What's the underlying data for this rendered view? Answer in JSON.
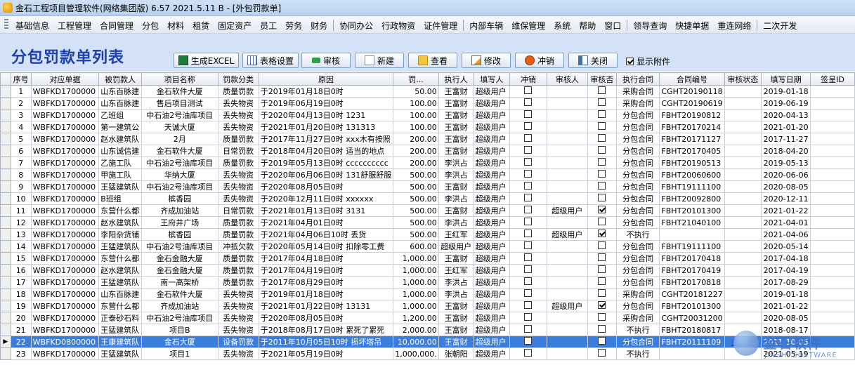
{
  "window": {
    "title": "金石工程项目管理软件(网络集团版) 6.57   2021.5.11 B - [外包罚款单]"
  },
  "menu": [
    "基础信息",
    "工程管理",
    "合同管理",
    "分包",
    "材料",
    "租赁",
    "固定资产",
    "员工",
    "劳务",
    "财务",
    "|",
    "协同办公",
    "行政物资",
    "证件管理",
    "|",
    "内部车辆",
    "维保管理",
    "系统",
    "帮助",
    "窗口",
    "|",
    "领导查询",
    "快捷单据",
    "重连网络",
    "|",
    "二次开发"
  ],
  "page_title": "分包罚款单列表",
  "toolbar": {
    "excel": "生成EXCEL",
    "table_settings": "表格设置",
    "approve": "审核",
    "new": "新建",
    "view": "查看",
    "edit": "修改",
    "offset": "冲销",
    "close": "关闭",
    "show_attachments": "显示附件",
    "show_attachments_checked": true
  },
  "columns": [
    "序号",
    "对应单据",
    "被罚款人",
    "项目名称",
    "罚款分类",
    "原因",
    "罚...",
    "执行人",
    "填写人",
    "冲销",
    "审核人",
    "审核否",
    "执行合同",
    "合同编号",
    "审核状态",
    "填写日期",
    "签呈ID"
  ],
  "rows": [
    {
      "no": "1",
      "doc": "WBFKD1700000",
      "person": "山东百脉建",
      "project": "金石软件大厦",
      "type": "质量罚款",
      "reason": "于2019年01月18日0时",
      "amount": "50.00",
      "exec": "王富财",
      "filler": "超级用户",
      "cx": false,
      "reviewer": "",
      "approved": false,
      "contract": "采购合同",
      "cno": "CGHT20190118",
      "status": "",
      "date": "2019-01-18",
      "sign": ""
    },
    {
      "no": "2",
      "doc": "WBFKD1700000",
      "person": "山东百脉建",
      "project": "售后项目测试",
      "type": "丢失物资",
      "reason": "于2019年06月19日0时",
      "amount": "100.00",
      "exec": "王富财",
      "filler": "超级用户",
      "cx": false,
      "reviewer": "",
      "approved": false,
      "contract": "采购合同",
      "cno": "CGHT20190619",
      "status": "",
      "date": "2019-06-19",
      "sign": ""
    },
    {
      "no": "3",
      "doc": "WBFKD1700000",
      "person": "乙班组",
      "project": "中石油2号油库项目",
      "type": "丢失物资",
      "reason": "于2020年04月13日0时  1231",
      "amount": "100.00",
      "exec": "王富财",
      "filler": "超级用户",
      "cx": false,
      "reviewer": "",
      "approved": false,
      "contract": "分包合同",
      "cno": "FBHT20190812",
      "status": "",
      "date": "2020-04-13",
      "sign": ""
    },
    {
      "no": "4",
      "doc": "WBFKD1700000",
      "person": "第一建筑公",
      "project": "天诚大厦",
      "type": "丢失物资",
      "reason": "于2021年01月20日0时  131313",
      "amount": "100.00",
      "exec": "王富财",
      "filler": "超级用户",
      "cx": false,
      "reviewer": "",
      "approved": false,
      "contract": "分包合同",
      "cno": "FBHT20170214",
      "status": "",
      "date": "2021-01-20",
      "sign": ""
    },
    {
      "no": "5",
      "doc": "WBFKD1700000",
      "person": "赵水建筑队",
      "project": "2月",
      "type": "质量罚款",
      "reason": "于2017年11月27日0时  xxx木有按照",
      "amount": "200.00",
      "exec": "王富财",
      "filler": "超级用户",
      "cx": false,
      "reviewer": "",
      "approved": false,
      "contract": "分包合同",
      "cno": "FBHT20171127",
      "status": "",
      "date": "2017-11-27",
      "sign": ""
    },
    {
      "no": "6",
      "doc": "WBFKD1700000",
      "person": "山东诚信建",
      "project": "金石软件大厦",
      "type": "日常罚款",
      "reason": "于2018年04月20日0时  适当的地点",
      "amount": "200.00",
      "exec": "王富财",
      "filler": "超级用户",
      "cx": false,
      "reviewer": "",
      "approved": false,
      "contract": "分包合同",
      "cno": "FBHT20170405",
      "status": "",
      "date": "2018-04-20",
      "sign": ""
    },
    {
      "no": "7",
      "doc": "WBFKD1700000",
      "person": "乙施工队",
      "project": "中石油2号油库项目",
      "type": "质量罚款",
      "reason": "于2019年05月13日0时  cccccccccc",
      "amount": "200.00",
      "exec": "李洪占",
      "filler": "超级用户",
      "cx": false,
      "reviewer": "",
      "approved": false,
      "contract": "分包合同",
      "cno": "FBHT20190513",
      "status": "",
      "date": "2019-05-13",
      "sign": ""
    },
    {
      "no": "8",
      "doc": "WBFKD1700000",
      "person": "甲施工队",
      "project": "华纳大厦",
      "type": "丢失物资",
      "reason": "于2020年06月06日0时  131舒服舒服",
      "amount": "500.00",
      "exec": "李洪占",
      "filler": "超级用户",
      "cx": false,
      "reviewer": "",
      "approved": false,
      "contract": "分包合同",
      "cno": "FBHT20060600",
      "status": "",
      "date": "2020-06-06",
      "sign": ""
    },
    {
      "no": "9",
      "doc": "WBFKD1700000",
      "person": "王猛建筑队",
      "project": "中石油2号油库项目",
      "type": "丢失物资",
      "reason": "于2020年08月05日0时",
      "amount": "500.00",
      "exec": "王富财",
      "filler": "超级用户",
      "cx": false,
      "reviewer": "",
      "approved": false,
      "contract": "分包合同",
      "cno": "FBHT19111100",
      "status": "",
      "date": "2020-08-05",
      "sign": ""
    },
    {
      "no": "10",
      "doc": "WBFKD1700000",
      "person": "B班组",
      "project": "槟香园",
      "type": "丢失物资",
      "reason": "于2020年12月11日0时  xxxxxx",
      "amount": "500.00",
      "exec": "李洪占",
      "filler": "超级用户",
      "cx": false,
      "reviewer": "",
      "approved": false,
      "contract": "分包合同",
      "cno": "FBHT20092800",
      "status": "",
      "date": "2020-12-11",
      "sign": ""
    },
    {
      "no": "11",
      "doc": "WBFKD1700000",
      "person": "东营什么都",
      "project": "齐成加油站",
      "type": "日常罚款",
      "reason": "于2021年01月13日0时  3131",
      "amount": "500.00",
      "exec": "王富财",
      "filler": "超级用户",
      "cx": false,
      "reviewer": "超级用户",
      "approved": true,
      "contract": "分包合同",
      "cno": "FBHT20101300",
      "status": "",
      "date": "2021-01-22",
      "sign": ""
    },
    {
      "no": "12",
      "doc": "WBFKD1700000",
      "person": "赵水建筑队",
      "project": "王府井广场",
      "type": "质量罚款",
      "reason": "于2021年04月01日0时",
      "amount": "500.00",
      "exec": "李洪占",
      "filler": "超级用户",
      "cx": false,
      "reviewer": "",
      "approved": false,
      "contract": "分包合同",
      "cno": "FBHT21040100",
      "status": "",
      "date": "2021-04-01",
      "sign": ""
    },
    {
      "no": "13",
      "doc": "WBFKD1700000",
      "person": "李阳杂货铺",
      "project": "槟香园",
      "type": "质量罚款",
      "reason": "于2021年04月06日10时  丢货",
      "amount": "500.00",
      "exec": "王红军",
      "filler": "超级用户",
      "cx": false,
      "reviewer": "超级用户",
      "approved": true,
      "contract": "不执行",
      "cno": "",
      "status": "",
      "date": "2021-04-06",
      "sign": ""
    },
    {
      "no": "14",
      "doc": "WBFKD1700000",
      "person": "王猛建筑队",
      "project": "中石油2号油库项目",
      "type": "冲抵欠款",
      "reason": "于2020年05月14日0时  扣除零工费",
      "amount": "600.00",
      "exec": "超级用户",
      "filler": "超级用户",
      "cx": false,
      "reviewer": "",
      "approved": false,
      "contract": "分包合同",
      "cno": "FBHT19111100",
      "status": "",
      "date": "2020-05-14",
      "sign": ""
    },
    {
      "no": "15",
      "doc": "WBFKD1700000",
      "person": "东营什么都",
      "project": "金石金融大厦",
      "type": "质量罚款",
      "reason": "于2017年04月18日0时",
      "amount": "1,000.00",
      "exec": "王富财",
      "filler": "超级用户",
      "cx": false,
      "reviewer": "",
      "approved": false,
      "contract": "分包合同",
      "cno": "FBHT20170418",
      "status": "",
      "date": "2017-04-18",
      "sign": ""
    },
    {
      "no": "16",
      "doc": "WBFKD1700000",
      "person": "赵水建筑队",
      "project": "金石金融大厦",
      "type": "质量罚款",
      "reason": "于2017年04月19日0时",
      "amount": "1,000.00",
      "exec": "王红军",
      "filler": "超级用户",
      "cx": false,
      "reviewer": "",
      "approved": false,
      "contract": "分包合同",
      "cno": "FBHT20170419",
      "status": "",
      "date": "2017-04-19",
      "sign": ""
    },
    {
      "no": "17",
      "doc": "WBFKD1700000",
      "person": "王猛建筑队",
      "project": "南一高架桥",
      "type": "质量罚款",
      "reason": "于2017年08月29日0时",
      "amount": "1,000.00",
      "exec": "李洪占",
      "filler": "超级用户",
      "cx": false,
      "reviewer": "",
      "approved": false,
      "contract": "分包合同",
      "cno": "FBHT20170818",
      "status": "",
      "date": "2017-08-29",
      "sign": ""
    },
    {
      "no": "18",
      "doc": "WBFKD1700000",
      "person": "山东百脉建",
      "project": "金石软件大厦",
      "type": "丢失物资",
      "reason": "于2019年01月18日0时",
      "amount": "1,000.00",
      "exec": "李洪占",
      "filler": "超级用户",
      "cx": false,
      "reviewer": "",
      "approved": false,
      "contract": "采购合同",
      "cno": "CGHT20181227",
      "status": "",
      "date": "2019-01-18",
      "sign": ""
    },
    {
      "no": "19",
      "doc": "WBFKD1700000",
      "person": "东营什么都",
      "project": "齐成加油站",
      "type": "丢失物资",
      "reason": "于2021年01月22日0时  13131",
      "amount": "1,000.00",
      "exec": "王富财",
      "filler": "超级用户",
      "cx": false,
      "reviewer": "超级用户",
      "approved": true,
      "contract": "分包合同",
      "cno": "FBHT20101300",
      "status": "",
      "date": "2021-01-22",
      "sign": ""
    },
    {
      "no": "20",
      "doc": "WBFKD1700000",
      "person": "正泰砂石料",
      "project": "中石油2号油库项目",
      "type": "丢失物资",
      "reason": "于2020年08月05日0时",
      "amount": "1,200.00",
      "exec": "王富财",
      "filler": "超级用户",
      "cx": false,
      "reviewer": "",
      "approved": false,
      "contract": "采购合同",
      "cno": "CGHT20031200",
      "status": "",
      "date": "2020-08-05",
      "sign": ""
    },
    {
      "no": "21",
      "doc": "WBFKD1700000",
      "person": "王猛建筑队",
      "project": "项目B",
      "type": "丢失物资",
      "reason": "于2018年08月17日0时  累死了累死",
      "amount": "2,000.00",
      "exec": "王富财",
      "filler": "超级用户",
      "cx": false,
      "reviewer": "",
      "approved": false,
      "contract": "不执行",
      "cno": "FBHT20180817",
      "status": "",
      "date": "2018-08-17",
      "sign": ""
    },
    {
      "no": "22",
      "doc": "WBFKD0800000",
      "person": "王康建筑队",
      "project": "金石大厦",
      "type": "设备罚款",
      "reason": "于2011年10月05日10时  损坏塔吊",
      "amount": "10,000.00",
      "exec": "王富财",
      "filler": "超级用户",
      "cx": false,
      "reviewer": "",
      "approved": false,
      "contract": "分包合同",
      "cno": "FBHT20111109",
      "status": "未审核",
      "date": "2011-10-05",
      "sign": ""
    },
    {
      "no": "23",
      "doc": "WBFKD1700000",
      "person": "王猛建筑队",
      "project": "项目1",
      "type": "丢失物资",
      "reason": "于2021年05月19日0时",
      "amount": "1,000,000.",
      "exec": "张朝阳",
      "filler": "超级用户",
      "cx": false,
      "reviewer": "",
      "approved": false,
      "contract": "不执行",
      "cno": "",
      "status": "",
      "date": "2021-05-19",
      "sign": ""
    }
  ],
  "selected_row": 21,
  "current_row_marker": "▶",
  "watermark": {
    "cn": "金石软件",
    "en": "JINSHI SOFTWARE"
  }
}
